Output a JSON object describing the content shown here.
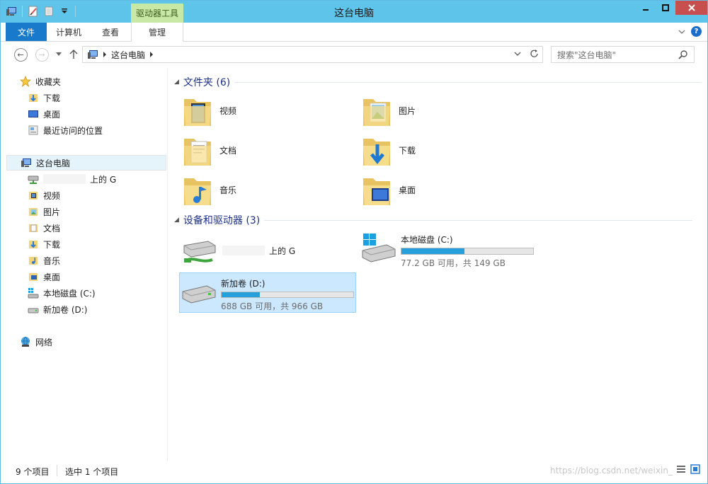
{
  "window": {
    "title": "这台电脑"
  },
  "ribbon": {
    "context_tab": "驱动器工具",
    "tabs": [
      {
        "label": "文件",
        "active": true
      },
      {
        "label": "计算机"
      },
      {
        "label": "查看"
      },
      {
        "label": "管理"
      }
    ]
  },
  "address": {
    "crumb": "这台电脑",
    "search_placeholder": "搜索\"这台电脑\""
  },
  "nav": {
    "favorites_label": "收藏夹",
    "favorites": [
      {
        "label": "下载",
        "icon": "download-folder-icon"
      },
      {
        "label": "桌面",
        "icon": "desktop-icon"
      },
      {
        "label": "最近访问的位置",
        "icon": "recent-places-icon"
      }
    ],
    "this_pc_label": "这台电脑",
    "this_pc_items": [
      {
        "label": "上的 G",
        "icon": "network-drive-icon"
      },
      {
        "label": "视频",
        "icon": "videos-folder-icon"
      },
      {
        "label": "图片",
        "icon": "pictures-folder-icon"
      },
      {
        "label": "文档",
        "icon": "documents-folder-icon"
      },
      {
        "label": "下载",
        "icon": "download-folder-icon"
      },
      {
        "label": "音乐",
        "icon": "music-folder-icon"
      },
      {
        "label": "桌面",
        "icon": "desktop-folder-icon"
      },
      {
        "label": "本地磁盘 (C:)",
        "icon": "system-drive-icon"
      },
      {
        "label": "新加卷 (D:)",
        "icon": "drive-icon"
      }
    ],
    "network_label": "网络"
  },
  "content": {
    "folders_header": "文件夹 (6)",
    "folders": [
      {
        "label": "视频",
        "icon": "videos-folder-icon"
      },
      {
        "label": "图片",
        "icon": "pictures-folder-icon"
      },
      {
        "label": "文档",
        "icon": "documents-folder-icon"
      },
      {
        "label": "下载",
        "icon": "download-folder-icon"
      },
      {
        "label": "音乐",
        "icon": "music-folder-icon"
      },
      {
        "label": "桌面",
        "icon": "desktop-folder-icon"
      }
    ],
    "devices_header": "设备和驱动器 (3)",
    "network_drive_label": "上的 G",
    "drive_c": {
      "label": "本地磁盘 (C:)",
      "free": "77.2 GB 可用，共 149 GB",
      "used_fraction": 0.48
    },
    "drive_d": {
      "label": "新加卷 (D:)",
      "free": "688 GB 可用，共 966 GB",
      "used_fraction": 0.29
    }
  },
  "status": {
    "count": "9 个项目",
    "selected": "选中 1 个项目",
    "watermark": "https://blog.csdn.net/weixin_"
  },
  "colors": {
    "accent": "#1979ca",
    "titlebar": "#5fc4ea",
    "context_tab": "#c8e9a6",
    "bar_fill": "#26a0da",
    "selection": "#cce8ff"
  }
}
